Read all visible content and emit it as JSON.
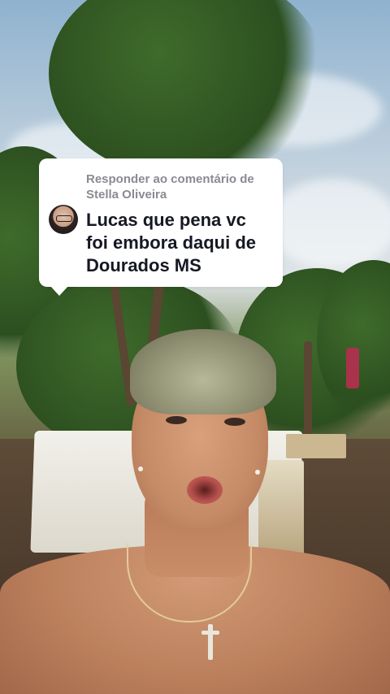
{
  "comment_reply": {
    "header_line1": "Responder ao comentário de",
    "header_line2": "Stella Oliveira",
    "body_line1": "Lucas que pena vc",
    "body_line2": "foi embora daqui de",
    "body_line3": "Dourados MS",
    "avatar_icon": "user-avatar-icon"
  },
  "colors": {
    "card_background": "#ffffff",
    "header_text": "#8a8b91",
    "body_text": "#161823"
  }
}
